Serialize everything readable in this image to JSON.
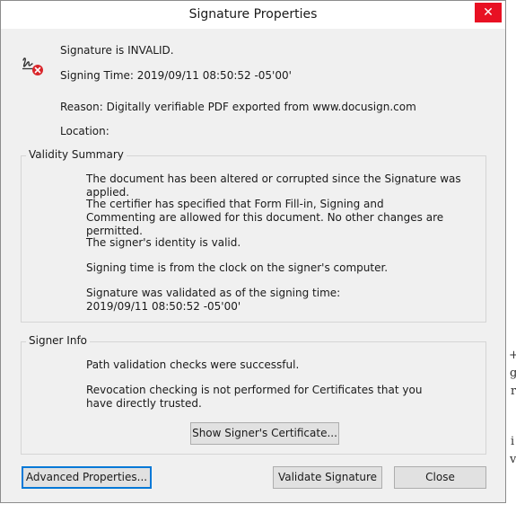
{
  "window": {
    "title": "Signature Properties",
    "close_glyph": "✕"
  },
  "signature": {
    "status_icon": "signature-invalid-icon",
    "status": "Signature is INVALID.",
    "signing_time": "Signing Time:  2019/09/11 08:50:52 -05'00'",
    "reason": "Reason:  Digitally verifiable PDF exported from www.docusign.com",
    "location": "Location:"
  },
  "validity_summary": {
    "label": "Validity Summary",
    "lines": [
      "The document has been altered or corrupted since the Signature was applied.",
      "The certifier has specified that Form Fill-in, Signing and Commenting are allowed for this document. No other changes are permitted.",
      "The signer's identity is valid.",
      "Signing time is from the clock on the signer's computer.",
      "Signature was validated as of the signing time:",
      "2019/09/11 08:50:52 -05'00'"
    ]
  },
  "signer_info": {
    "label": "Signer Info",
    "lines": [
      "Path validation checks were successful.",
      "Revocation checking is not performed for Certificates that you have directly trusted."
    ],
    "show_certificate_button": "Show Signer's Certificate..."
  },
  "buttons": {
    "advanced": "Advanced Properties...",
    "validate": "Validate Signature",
    "close": "Close"
  },
  "colors": {
    "dialog_bg": "#f0f0f0",
    "close_hover": "#e81123",
    "focus_border": "#0078d7",
    "invalid_red": "#d9262b"
  }
}
